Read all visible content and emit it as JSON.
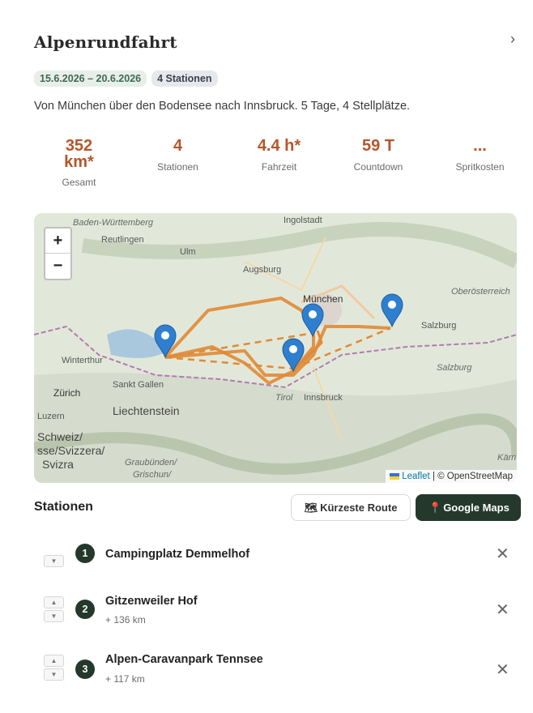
{
  "header": {
    "title": "Alpenrundfahrt",
    "close_glyph": "›",
    "date_range": "15.6.2026 – 20.6.2026",
    "stations_badge": "4 Stationen",
    "description": "Von München über den Bodensee nach Innsbruck. 5 Tage, 4 Stellplätze."
  },
  "stats": [
    {
      "value": "352\nkm*",
      "label": "Gesamt"
    },
    {
      "value": "4",
      "label": "Stationen"
    },
    {
      "value": "4.4 h*",
      "label": "Fahrzeit"
    },
    {
      "value": "59 T",
      "label": "Countdown"
    },
    {
      "value": "...",
      "label": "Spritkosten"
    }
  ],
  "map": {
    "zoom_in": "+",
    "zoom_out": "−",
    "attribution_leaflet": "Leaflet",
    "attribution_osm": "| © OpenStreetMap",
    "labels": {
      "bw": "Baden-Württemberg",
      "ingolstadt": "Ingolstadt",
      "reutlingen": "Reutlingen",
      "ulm": "Ulm",
      "augsburg": "Augsburg",
      "muenchen": "München",
      "oberoesterreich": "Oberösterreich",
      "salzburg_city": "Salzburg",
      "salzburg_region": "Salzburg",
      "winterthur": "Winterthur",
      "sankt_gallen": "Sankt Gallen",
      "zuerich": "Zürich",
      "liechtenstein": "Liechtenstein",
      "tirol": "Tirol",
      "innsbruck": "Innsbruck",
      "luzern": "Luzern",
      "schweiz1": "Schweiz/",
      "schweiz2": "sse/Svizzera/",
      "schweiz3": "Svizra",
      "graubuenden1": "Graubünden/",
      "graubuenden2": "Grischun/",
      "kaernten": "Kärn"
    }
  },
  "stations_section": {
    "title": "Stationen",
    "route_button": "Kürzeste Route",
    "route_icon": "🗺",
    "gmaps_button": "Google Maps",
    "gmaps_icon": "📍",
    "remove_glyph": "✕",
    "up_glyph": "▲",
    "down_glyph": "▼",
    "items": [
      {
        "number": "1",
        "name": "Campingplatz Demmelhof",
        "distance": ""
      },
      {
        "number": "2",
        "name": "Gitzenweiler Hof",
        "distance": "+ 136 km"
      },
      {
        "number": "3",
        "name": "Alpen-Caravanpark Tennsee",
        "distance": "+ 117 km"
      }
    ]
  },
  "colors": {
    "accent_orange": "#b5552b",
    "dark_green": "#24392c",
    "route": "#e08a35",
    "marker": "#2f7fd0"
  }
}
